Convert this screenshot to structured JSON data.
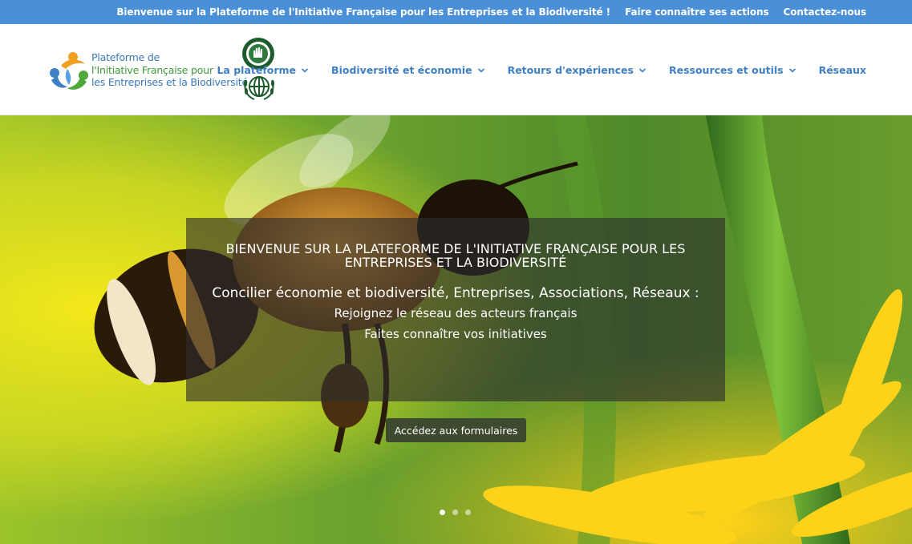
{
  "topbar": {
    "links": [
      {
        "label": "Bienvenue sur la Plateforme de l'Initiative Française pour les Entreprises et la Biodiversité !"
      },
      {
        "label": "Faire connaître ses actions"
      },
      {
        "label": "Contactez-nous"
      }
    ],
    "bg_color": "#4a90d9"
  },
  "header": {
    "logo_text": {
      "line1": "Plateforme de",
      "line2": "l'Initiative Française pour",
      "line3": "les Entreprises et la Biodiversité"
    },
    "nav": [
      {
        "label": "La plateforme",
        "has_dropdown": true
      },
      {
        "label": "Biodiversité et économie",
        "has_dropdown": true
      },
      {
        "label": "Retours d'expériences",
        "has_dropdown": true
      },
      {
        "label": "Ressources et outils",
        "has_dropdown": true
      },
      {
        "label": "Réseaux",
        "has_dropdown": false
      }
    ],
    "nav_color": "#3f7fc4"
  },
  "hero": {
    "title": "BIENVENUE SUR LA PLATEFORME DE L'INITIATIVE FRANÇAISE POUR LES ENTREPRISES ET LA BIODIVERSITÉ",
    "subtitle": "Concilier économie et biodiversité, Entreprises, Associations, Réseaux :",
    "lines": [
      "Rejoignez le réseau des acteurs français",
      "Faites connaître vos initiatives"
    ],
    "cta_label": "Accédez aux formulaires",
    "slides_count": 3,
    "active_slide": 1
  }
}
